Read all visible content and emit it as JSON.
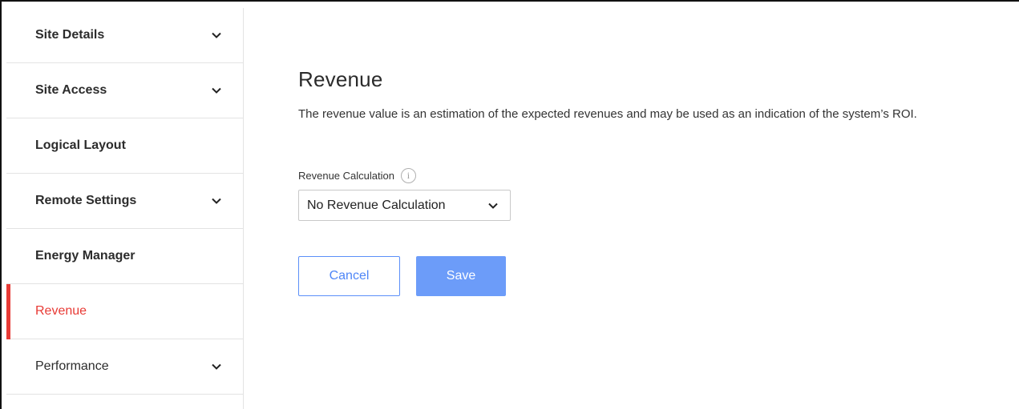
{
  "sidebar": {
    "items": [
      {
        "label": "Site Details",
        "has_chevron": true
      },
      {
        "label": "Site Access",
        "has_chevron": true
      },
      {
        "label": "Logical Layout",
        "has_chevron": false
      },
      {
        "label": "Remote Settings",
        "has_chevron": true
      },
      {
        "label": "Energy Manager",
        "has_chevron": false
      },
      {
        "label": "Revenue",
        "has_chevron": false,
        "active": true
      },
      {
        "label": "Performance",
        "has_chevron": true
      }
    ]
  },
  "main": {
    "title": "Revenue",
    "description": "The revenue value is an estimation of the expected revenues and may be used as an indication of the system’s ROI.",
    "field": {
      "label": "Revenue Calculation",
      "info_icon": "i",
      "selected_value": "No Revenue Calculation"
    },
    "buttons": {
      "cancel_label": "Cancel",
      "save_label": "Save"
    }
  },
  "colors": {
    "accent_active": "#e83a35",
    "primary_blue": "#6c9cf9",
    "cancel_border": "#5b8ff9"
  }
}
